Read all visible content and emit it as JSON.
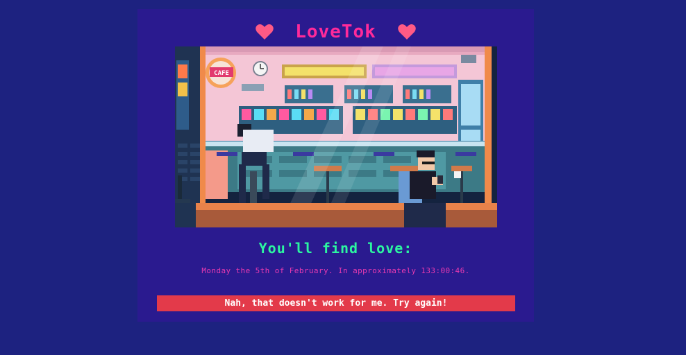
{
  "app": {
    "title": "LoveTok"
  },
  "result": {
    "headline": "You'll find love:",
    "prediction": "Monday the 5th of February. In approximately 133:00:46."
  },
  "actions": {
    "retry_label": "Nah, that doesn't work for me. Try again!"
  },
  "theme": {
    "page_bg": "#1d2280",
    "card_bg": "#2a1a8f",
    "title_color": "#ff2a9a",
    "heart_color": "#ff5a85",
    "headline_color": "#2cf5a0",
    "prediction_color": "#e83ab0",
    "button_color": "#e33a4a"
  },
  "icons": {
    "left": "heart-icon",
    "right": "heart-icon"
  },
  "image": {
    "shop_sign": "CAFE"
  }
}
